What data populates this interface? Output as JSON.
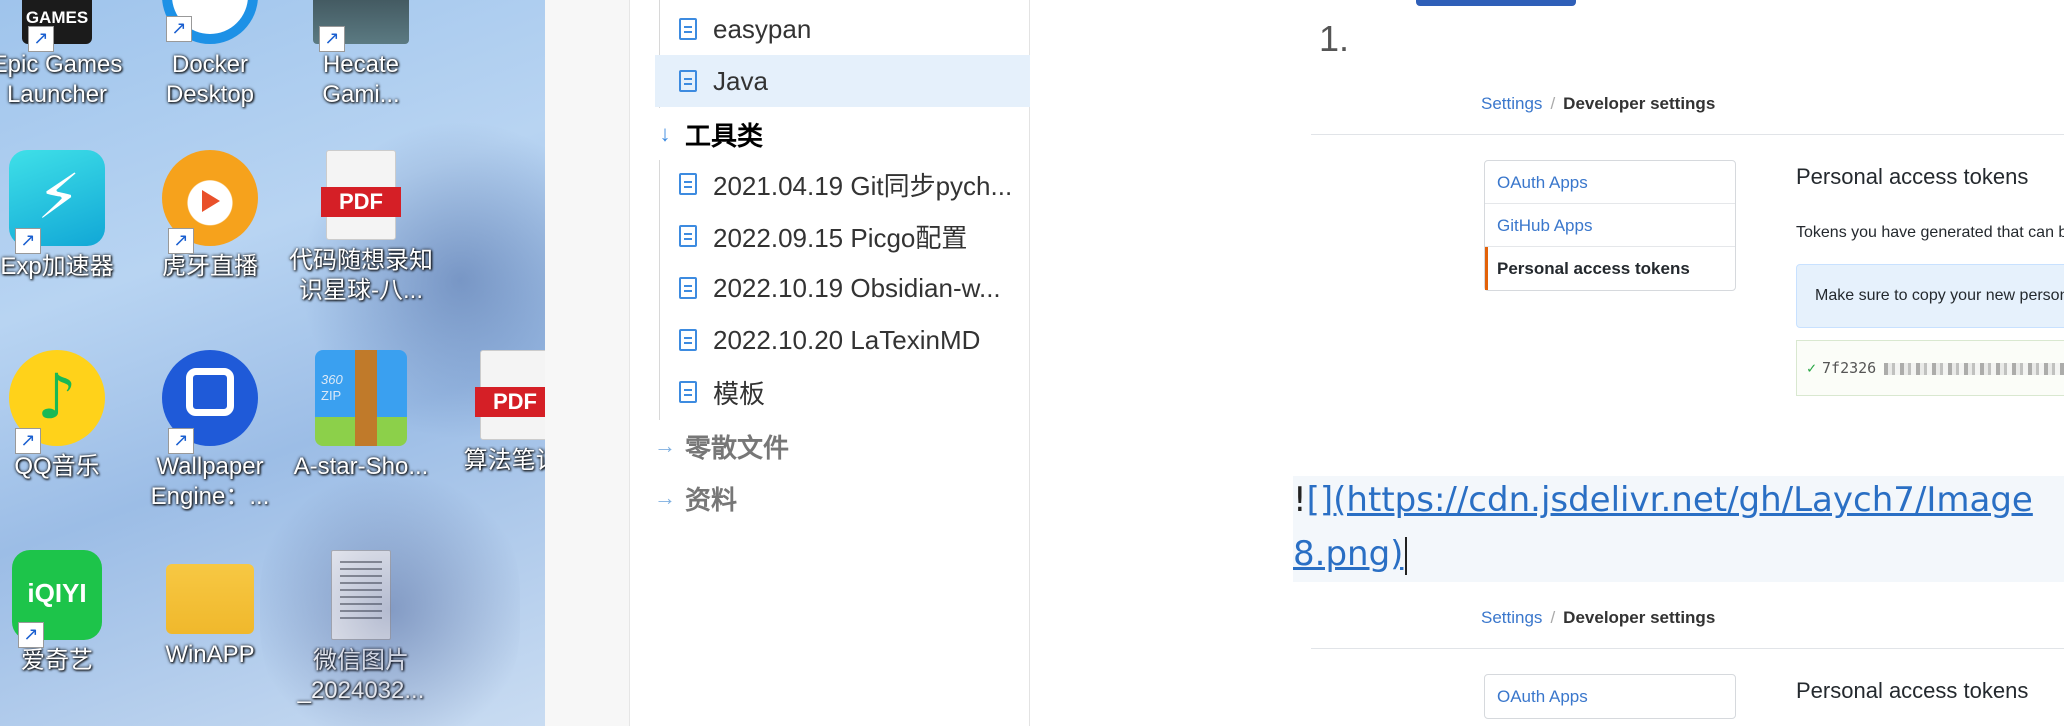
{
  "desktop": {
    "icons": [
      {
        "label_1": "GAMES",
        "label_2": "",
        "caption_1": "Epic Games",
        "caption_2": "Launcher",
        "icon": "epic-games-icon"
      },
      {
        "caption_1": "Docker",
        "caption_2": "Desktop",
        "icon": "docker-icon"
      },
      {
        "caption_1": "Hecate",
        "caption_2": "Gami...",
        "icon": "hecate-icon"
      },
      {
        "caption_1": "Exp加速器",
        "caption_2": "",
        "icon": "exp-accelerator-icon"
      },
      {
        "caption_1": "虎牙直播",
        "caption_2": "",
        "icon": "huya-icon"
      },
      {
        "caption_1": "代码随想录知",
        "caption_2": "识星球-八...",
        "badge": "PDF",
        "icon": "pdf-icon"
      },
      {
        "caption_1": "QQ音乐",
        "caption_2": "",
        "icon": "qq-music-icon"
      },
      {
        "caption_1": "Wallpaper",
        "caption_2": "Engine：...",
        "icon": "wallpaper-engine-icon"
      },
      {
        "caption_1": "A-star-Sho...",
        "caption_2": "",
        "badge": "ZIP",
        "brand": "360",
        "icon": "zip-archive-icon"
      },
      {
        "caption_1": "算法笔记.",
        "caption_2": "",
        "badge": "PDF",
        "icon": "pdf-icon"
      },
      {
        "caption_1": "爱奇艺",
        "caption_2": "",
        "badge": "iQIYI",
        "icon": "iqiyi-icon"
      },
      {
        "caption_1": "WinAPP",
        "caption_2": "",
        "icon": "folder-icon"
      },
      {
        "caption_1": "微信图片",
        "caption_2": "_2024032...",
        "icon": "image-file-icon"
      }
    ]
  },
  "sidebar": {
    "files_top": [
      "easypan",
      "Java"
    ],
    "folder_tools": "工具类",
    "files_tools": [
      "2021.04.19 Git同步pych...",
      "2022.09.15 Picgo配置",
      "2022.10.19 Obsidian-w...",
      "2022.10.20 LaTexinMD",
      "模板"
    ],
    "folder_misc": "零散文件",
    "folder_materials": "资料"
  },
  "editor": {
    "list_number": "1.",
    "gh_shot_1": {
      "crumb_first": "Settings",
      "crumb_sep": "/",
      "crumb_last": "Developer settings",
      "nav": [
        "OAuth Apps",
        "GitHub Apps",
        "Personal access tokens"
      ],
      "title": "Personal access tokens",
      "desc": "Tokens you have generated that can be u",
      "flash": "Make sure to copy your new personal a",
      "token_prefix": "7f2326"
    },
    "md_bang": "!",
    "md_line_1": "[](https://cdn.jsdelivr.net/gh/Laych7/Image",
    "md_line_2": "8.png)",
    "gh_shot_2": {
      "crumb_first": "Settings",
      "crumb_sep": "/",
      "crumb_last": "Developer settings",
      "nav": [
        "OAuth Apps"
      ],
      "title": "Personal access tokens"
    }
  },
  "colors": {
    "accent": "#3d8be0",
    "link": "#2a6fc4",
    "active_row": "#e5f0fb"
  }
}
